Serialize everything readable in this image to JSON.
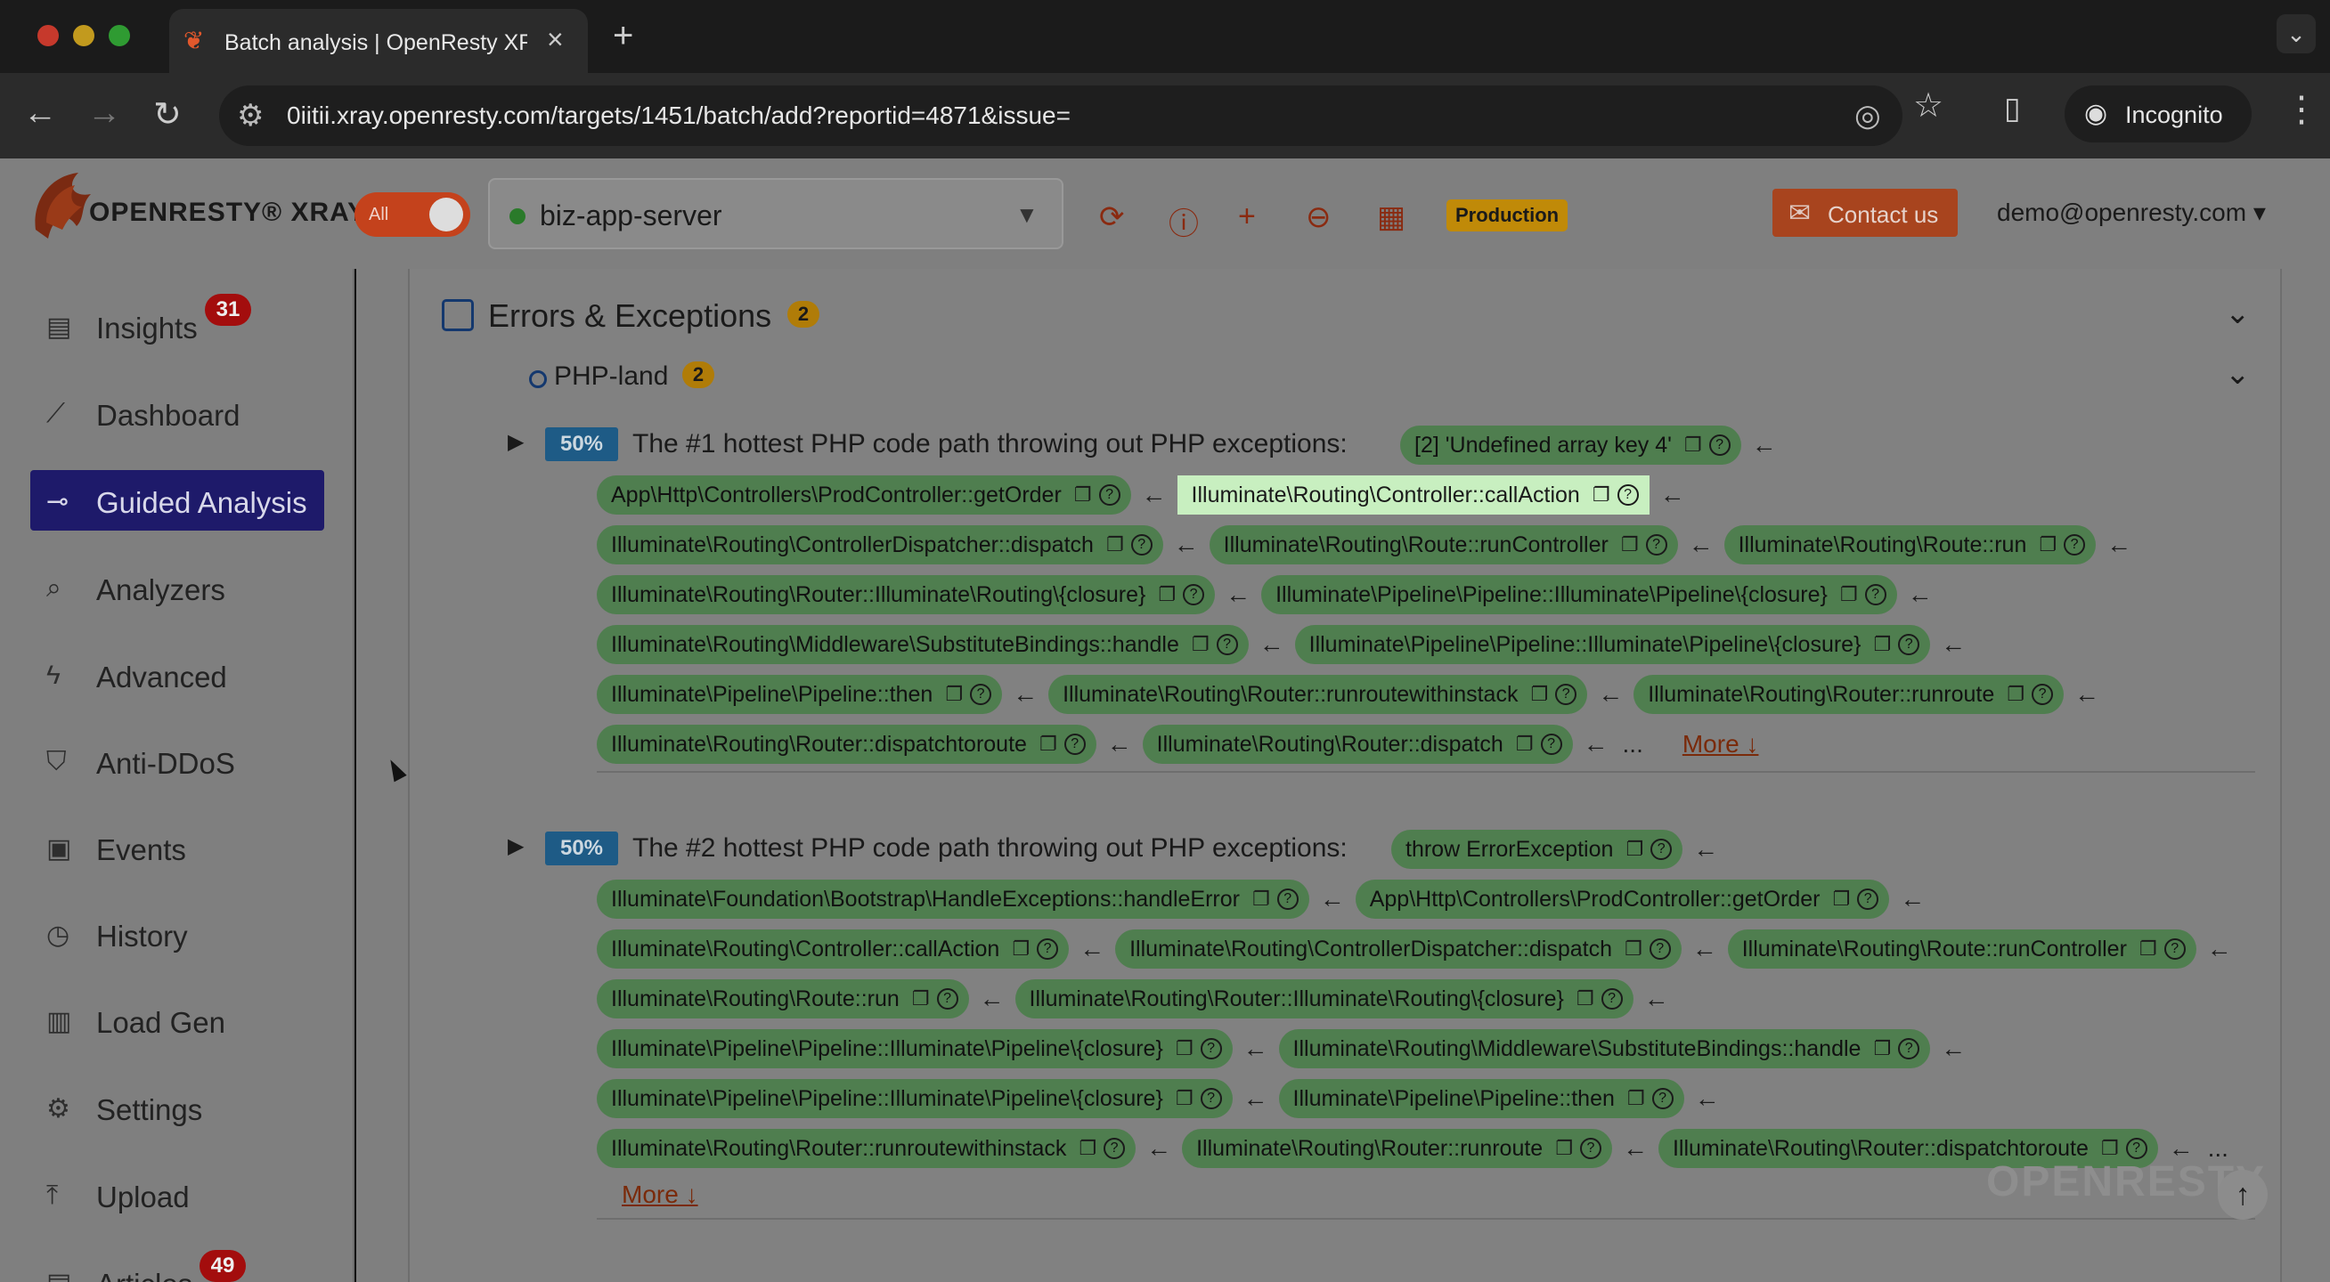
{
  "browser": {
    "tab_title": "Batch analysis | OpenResty XRay",
    "new_tab": "+",
    "url": "0iitii.xray.openresty.com/targets/1451/batch/add?reportid=4871&issue=",
    "incognito_label": "Incognito"
  },
  "header": {
    "logo_text": "OPENRESTY® XRAY",
    "toggle_label": "All",
    "server_name": "biz-app-server",
    "env_badge": "Production",
    "contact_label": "Contact us",
    "user_email": "demo@openresty.com",
    "icons": [
      "refresh-icon",
      "info-icon",
      "plus-icon",
      "minus-icon",
      "calendar-icon"
    ]
  },
  "sidebar": {
    "items": [
      {
        "label": "Insights",
        "icon": "insights-icon",
        "count": "31"
      },
      {
        "label": "Dashboard",
        "icon": "dashboard-icon"
      },
      {
        "label": "Guided Analysis",
        "icon": "guided-analysis-icon",
        "active": true
      },
      {
        "label": "Analyzers",
        "icon": "analyzers-icon"
      },
      {
        "label": "Advanced",
        "icon": "advanced-icon"
      },
      {
        "label": "Anti-DDoS",
        "icon": "shield-icon"
      },
      {
        "label": "Events",
        "icon": "events-icon"
      },
      {
        "label": "History",
        "icon": "history-icon"
      },
      {
        "label": "Load Gen",
        "icon": "load-gen-icon"
      },
      {
        "label": "Settings",
        "icon": "gear-icon"
      },
      {
        "label": "Upload",
        "icon": "upload-icon"
      },
      {
        "label": "Articles",
        "icon": "articles-icon",
        "count": "49"
      }
    ]
  },
  "main": {
    "section_title": "Errors & Exceptions",
    "section_count": "2",
    "subsection_title": "PHP-land",
    "subsection_count": "2",
    "blocks": [
      {
        "percent": "50%",
        "title": "The #1 hottest PHP code path throwing out PHP exceptions:",
        "head_chip": "[2] 'Undefined array key 4'",
        "rows": [
          [
            "App\\Http\\Controllers\\ProdController::getOrder",
            "Illuminate\\Routing\\Controller::callAction"
          ],
          [
            "Illuminate\\Routing\\ControllerDispatcher::dispatch",
            "Illuminate\\Routing\\Route::runController",
            "Illuminate\\Routing\\Route::run"
          ],
          [
            "Illuminate\\Routing\\Router::Illuminate\\Routing\\{closure}",
            "Illuminate\\Pipeline\\Pipeline::Illuminate\\Pipeline\\{closure}"
          ],
          [
            "Illuminate\\Routing\\Middleware\\SubstituteBindings::handle",
            "Illuminate\\Pipeline\\Pipeline::Illuminate\\Pipeline\\{closure}"
          ],
          [
            "Illuminate\\Pipeline\\Pipeline::then",
            "Illuminate\\Routing\\Router::runroutewithinstack",
            "Illuminate\\Routing\\Router::runroute"
          ],
          [
            "Illuminate\\Routing\\Router::dispatchtoroute",
            "Illuminate\\Routing\\Router::dispatch"
          ]
        ],
        "more_label": "More ↓"
      },
      {
        "percent": "50%",
        "title": "The #2 hottest PHP code path throwing out PHP exceptions:",
        "head_chip": "throw ErrorException",
        "rows": [
          [
            "Illuminate\\Foundation\\Bootstrap\\HandleExceptions::handleError",
            "App\\Http\\Controllers\\ProdController::getOrder"
          ],
          [
            "Illuminate\\Routing\\Controller::callAction",
            "Illuminate\\Routing\\ControllerDispatcher::dispatch",
            "Illuminate\\Routing\\Route::runController"
          ],
          [
            "Illuminate\\Routing\\Route::run",
            "Illuminate\\Routing\\Router::Illuminate\\Routing\\{closure}"
          ],
          [
            "Illuminate\\Pipeline\\Pipeline::Illuminate\\Pipeline\\{closure}",
            "Illuminate\\Routing\\Middleware\\SubstituteBindings::handle"
          ],
          [
            "Illuminate\\Pipeline\\Pipeline::Illuminate\\Pipeline\\{closure}",
            "Illuminate\\Pipeline\\Pipeline::then"
          ],
          [
            "Illuminate\\Routing\\Router::runroutewithinstack",
            "Illuminate\\Routing\\Router::runroute",
            "Illuminate\\Routing\\Router::dispatchtoroute"
          ]
        ],
        "more_label": "More ↓"
      }
    ]
  },
  "watermark": "OPENRESTY"
}
